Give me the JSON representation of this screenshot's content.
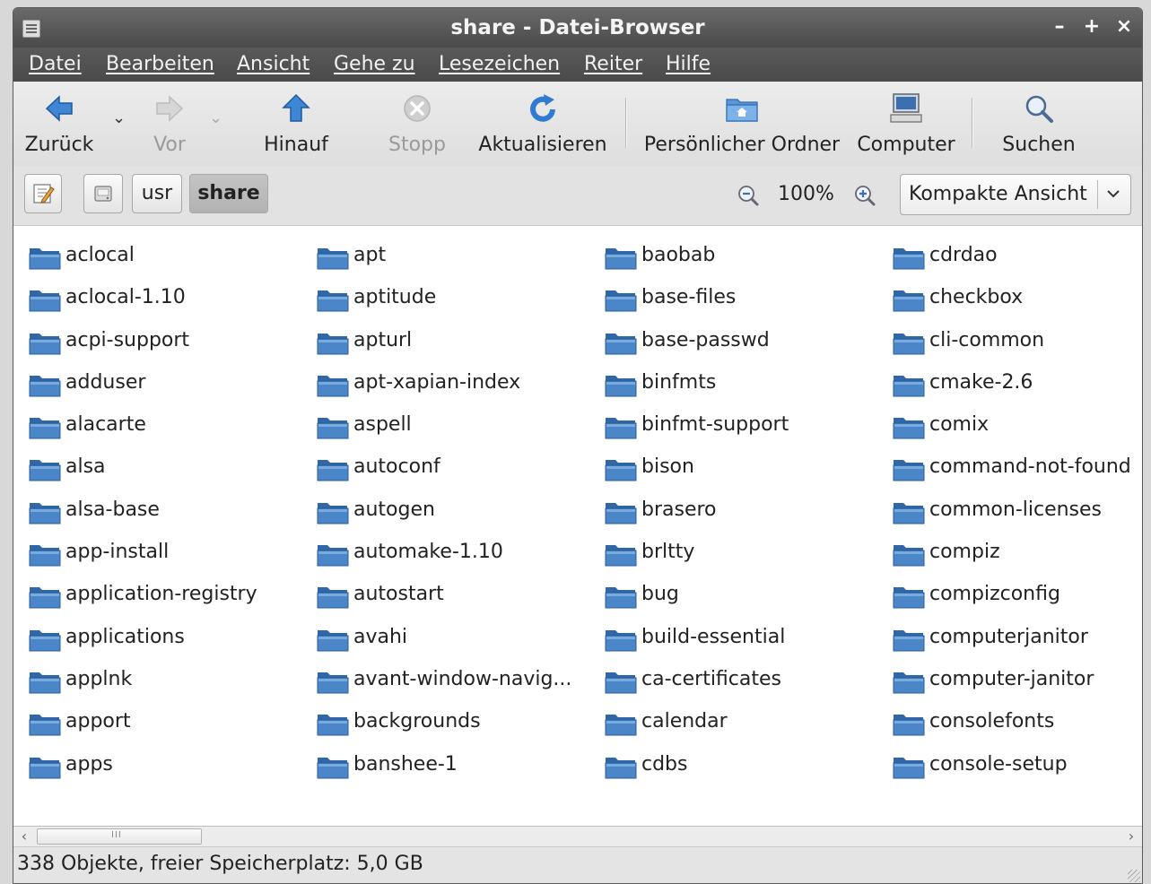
{
  "window": {
    "title": "share - Datei-Browser",
    "controls": {
      "minimize": "–",
      "maximize": "+",
      "close": "×"
    }
  },
  "menubar": [
    "Datei",
    "Bearbeiten",
    "Ansicht",
    "Gehe zu",
    "Lesezeichen",
    "Reiter",
    "Hilfe"
  ],
  "toolbar": {
    "back": "Zurück",
    "forward": "Vor",
    "up": "Hinauf",
    "stop": "Stopp",
    "reload": "Aktualisieren",
    "home": "Persönlicher Ordner",
    "computer": "Computer",
    "search": "Suchen"
  },
  "location": {
    "path": [
      "usr",
      "share"
    ],
    "zoom": "100%",
    "view_mode": "Kompakte Ansicht"
  },
  "files": {
    "columns": [
      [
        "aclocal",
        "aclocal-1.10",
        "acpi-support",
        "adduser",
        "alacarte",
        "alsa",
        "alsa-base",
        "app-install",
        "application-registry",
        "applications",
        "applnk",
        "apport",
        "apps"
      ],
      [
        "apt",
        "aptitude",
        "apturl",
        "apt-xapian-index",
        "aspell",
        "autoconf",
        "autogen",
        "automake-1.10",
        "autostart",
        "avahi",
        "avant-window-navig...",
        "backgrounds",
        "banshee-1"
      ],
      [
        "baobab",
        "base-files",
        "base-passwd",
        "binfmts",
        "binfmt-support",
        "bison",
        "brasero",
        "brltty",
        "bug",
        "build-essential",
        "ca-certificates",
        "calendar",
        "cdbs"
      ],
      [
        "cdrdao",
        "checkbox",
        "cli-common",
        "cmake-2.6",
        "comix",
        "command-not-found",
        "common-licenses",
        "compiz",
        "compizconfig",
        "computerjanitor",
        "computer-janitor",
        "consolefonts",
        "console-setup"
      ]
    ]
  },
  "status": "338 Objekte, freier Speicherplatz: 5,0 GB",
  "colors": {
    "folder": "#4a86c8",
    "titlebar": "#555555"
  }
}
